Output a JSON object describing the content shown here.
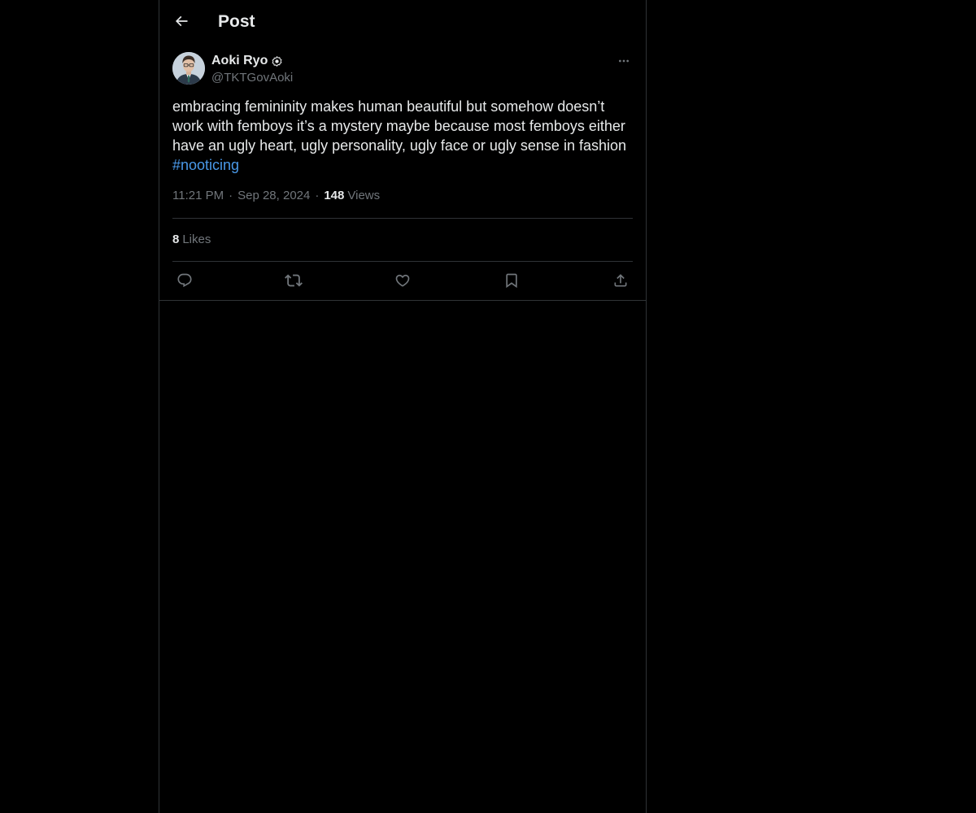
{
  "header": {
    "title": "Post",
    "back_icon": "arrow-left-icon"
  },
  "post": {
    "author": {
      "name": "Aoki Ryo",
      "handle": "@TKTGovAoki",
      "badge_icon": "verified-badge-icon"
    },
    "text": "embracing femininity makes human beautiful but somehow doesn’t work with femboys it’s a mystery maybe because most femboys either have an ugly heart, ugly personality, ugly face or ugly sense in fashion",
    "hashtag": "#nooticing",
    "time": "11:21 PM",
    "separator": "·",
    "date": "Sep 28, 2024",
    "views_count": "148",
    "views_label": "Views",
    "likes_count": "8",
    "likes_label": "Likes"
  },
  "actions": {
    "reply_icon": "reply-icon",
    "repost_icon": "repost-icon",
    "like_icon": "heart-icon",
    "bookmark_icon": "bookmark-icon",
    "share_icon": "share-icon"
  },
  "colors": {
    "background": "#000000",
    "text": "#e7e9ea",
    "secondary_text": "#71767b",
    "link": "#4a99e9",
    "border": "#2f3336"
  }
}
